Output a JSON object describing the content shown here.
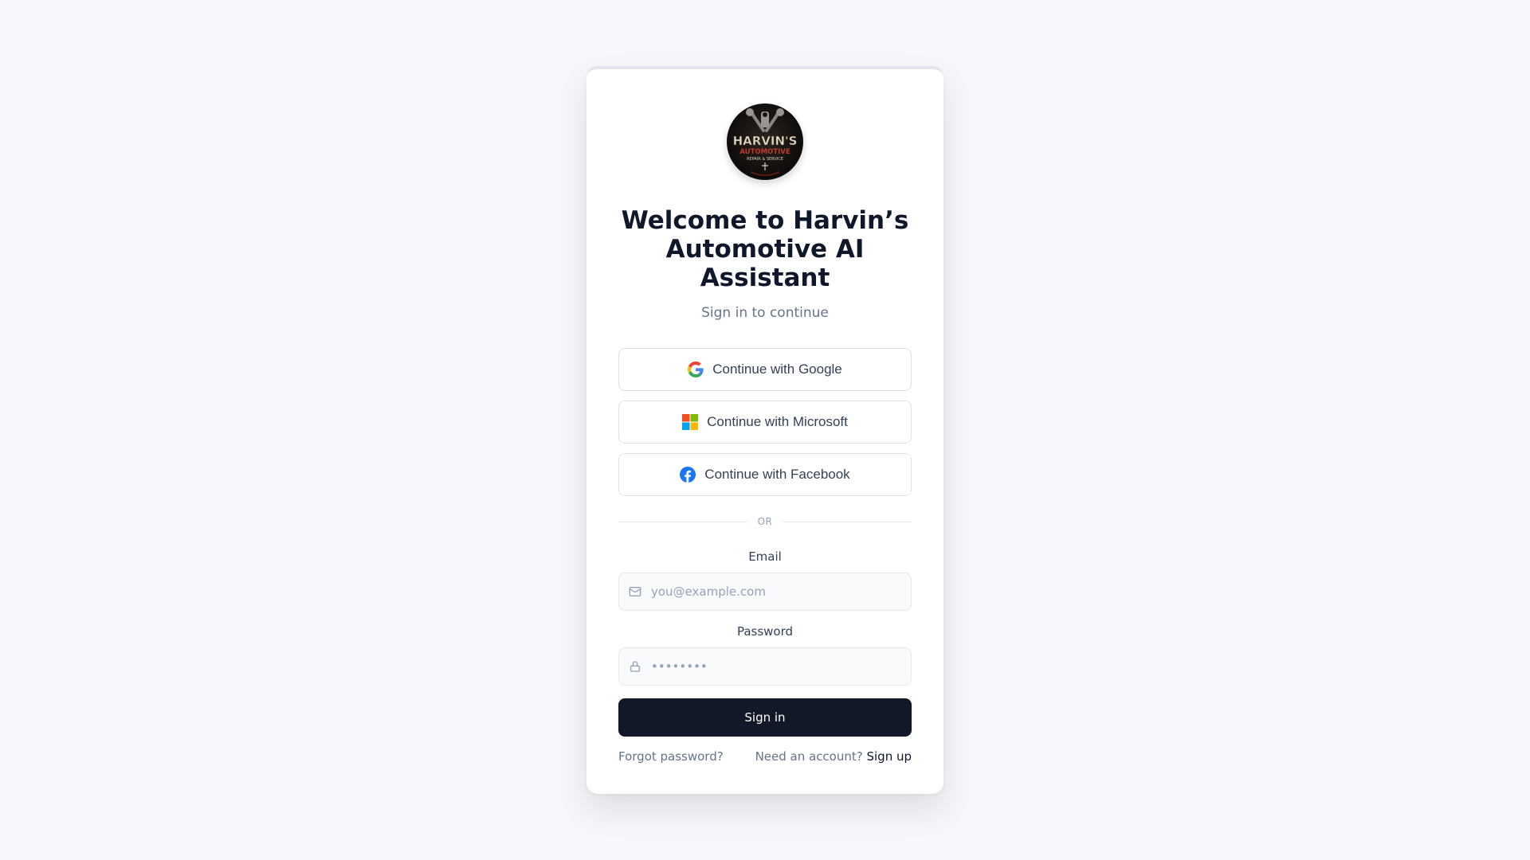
{
  "brand": {
    "logo_icon": "harvins-automotive-logo",
    "logo_text_line1": "HARVIN'S",
    "logo_text_line2": "AUTOMOTIVE",
    "logo_text_line3": "REPAIR & SERVICE"
  },
  "header": {
    "title": "Welcome to Harvin’s Automotive AI Assistant",
    "subtitle": "Sign in to continue"
  },
  "oauth": {
    "google_label": "Continue with Google",
    "microsoft_label": "Continue with Microsoft",
    "facebook_label": "Continue with Facebook"
  },
  "divider": {
    "label": "OR"
  },
  "form": {
    "email_label": "Email",
    "email_placeholder": "you@example.com",
    "email_value": "",
    "password_label": "Password",
    "password_placeholder": "••••••••",
    "password_value": "",
    "submit_label": "Sign in"
  },
  "footer": {
    "forgot_label": "Forgot password?",
    "need_account_label": "Need an account?",
    "signup_label": "Sign up"
  },
  "colors": {
    "background": "#f5f7fa",
    "card": "#ffffff",
    "primary_button": "#111827",
    "heading": "#0f172a",
    "muted": "#64748b",
    "facebook": "#1877f2"
  }
}
